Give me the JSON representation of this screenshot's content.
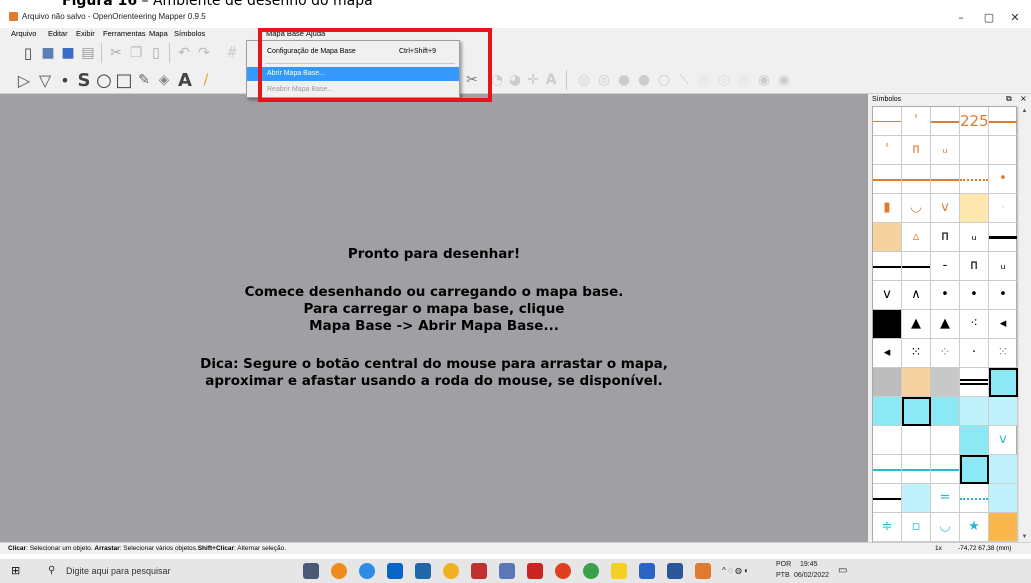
{
  "caption": {
    "prefix": "Figura 16",
    "rest": " – Ambiente de desenho do mapa"
  },
  "window": {
    "title": "Arquivo não salvo - OpenOrienteering Mapper 0.9.5",
    "minimize": "–",
    "maximize": "▢",
    "close": "✕"
  },
  "menu": {
    "arquivo": "Arquivo",
    "editar": "Editar",
    "exibir": "Exibir",
    "ferramentas": "Ferramentas",
    "mapa": "Mapa",
    "simbolos": "Símbolos",
    "mapa_base": "Mapa Base",
    "ajuda": "Ajuda"
  },
  "dropdown": {
    "item1": "Configuração de Mapa Base",
    "item1_shortcut": "Ctrl+Shift+9",
    "item2": "Abrir Mapa Base...",
    "item3": "Reabrir Mapa Base..."
  },
  "canvas": {
    "line1": "Pronto para desenhar!",
    "line2": "Comece desenhando ou carregando o mapa base.",
    "line3": "Para carregar o mapa base, clique",
    "line4": "Mapa Base -> Abrir Mapa Base...",
    "line5": "Dica: Segure o botão central do mouse para arrastar o mapa,",
    "line6": "aproximar e afastar usando a roda do mouse, se disponível."
  },
  "panel": {
    "title": "Símbolos",
    "symbol_225": "225"
  },
  "status": {
    "click_label": "Clicar",
    "click_text": ": Selecionar um objeto. ",
    "drag_label": "Arrastar",
    "drag_text": ": Selecionar vários objetos.",
    "shift_label": "Shift+Clicar",
    "shift_text": ": Alternar seleção.",
    "zoom": "1x",
    "coords": "-74,72 67,38 (mm)"
  },
  "taskbar": {
    "search_placeholder": "Digite aqui para pesquisar",
    "lang1": "POR",
    "lang2": "PTB",
    "time": "19:45",
    "date": "06/02/2022"
  },
  "colors": {
    "canvas": "#a0a0a4",
    "highlight": "#e8141b",
    "selection": "#3399ff",
    "symbol_orange": "#e07a2e",
    "symbol_cyan": "#8de8f5"
  }
}
